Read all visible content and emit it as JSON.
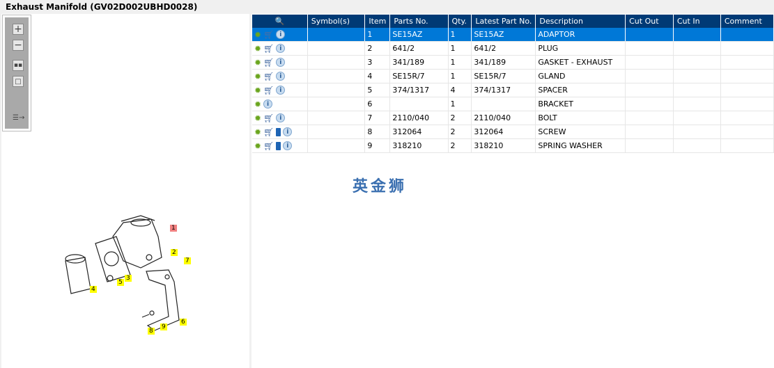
{
  "window": {
    "title": "Exhaust Manifold (GV02D002UBHD0028)"
  },
  "table": {
    "headers": [
      "Symbol(s)",
      "Item",
      "Parts No.",
      "Qty.",
      "Latest Part No.",
      "Description",
      "Cut Out",
      "Cut In",
      "Comment"
    ],
    "rows": [
      {
        "item": "1",
        "part": "SE15AZ",
        "qty": "1",
        "latest": "SE15AZ",
        "desc": "ADAPTOR",
        "icons": [
          "gear",
          "cart",
          "info"
        ]
      },
      {
        "item": "2",
        "part": "641/2",
        "qty": "1",
        "latest": "641/2",
        "desc": "PLUG",
        "icons": [
          "gear",
          "cart",
          "info"
        ]
      },
      {
        "item": "3",
        "part": "341/189",
        "qty": "1",
        "latest": "341/189",
        "desc": "GASKET - EXHAUST",
        "icons": [
          "gear",
          "cart",
          "info"
        ]
      },
      {
        "item": "4",
        "part": "SE15R/7",
        "qty": "1",
        "latest": "SE15R/7",
        "desc": "GLAND",
        "icons": [
          "gear",
          "cart",
          "info"
        ]
      },
      {
        "item": "5",
        "part": "374/1317",
        "qty": "4",
        "latest": "374/1317",
        "desc": "SPACER",
        "icons": [
          "gear",
          "cart",
          "info"
        ]
      },
      {
        "item": "6",
        "part": "",
        "qty": "1",
        "latest": "",
        "desc": "BRACKET",
        "icons": [
          "gear",
          "info"
        ]
      },
      {
        "item": "7",
        "part": "2110/040",
        "qty": "2",
        "latest": "2110/040",
        "desc": "BOLT",
        "icons": [
          "gear",
          "cart",
          "info"
        ]
      },
      {
        "item": "8",
        "part": "312064",
        "qty": "2",
        "latest": "312064",
        "desc": "SCREW",
        "icons": [
          "gear",
          "cart",
          "book",
          "info"
        ]
      },
      {
        "item": "9",
        "part": "318210",
        "qty": "2",
        "latest": "318210",
        "desc": "SPRING WASHER",
        "icons": [
          "gear",
          "cart",
          "book",
          "info"
        ]
      }
    ]
  },
  "watermark": "英金狮",
  "diagram": {
    "callouts": [
      "1",
      "2",
      "3",
      "4",
      "5",
      "6",
      "7",
      "8",
      "9"
    ]
  }
}
